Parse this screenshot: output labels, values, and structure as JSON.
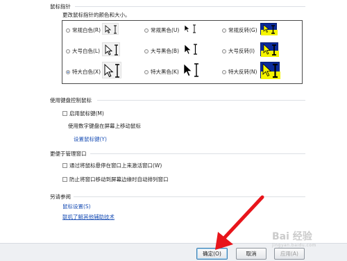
{
  "pointer_group": {
    "title": "鼠标指针",
    "description": "更改鼠标指针的颜色和大小。",
    "options": [
      {
        "label": "常规白色(R)",
        "selected": false,
        "scheme": "white",
        "size": "normal"
      },
      {
        "label": "常规黑色(U)",
        "selected": false,
        "scheme": "black",
        "size": "normal"
      },
      {
        "label": "常规反转(G)",
        "selected": false,
        "scheme": "inverted",
        "size": "normal"
      },
      {
        "label": "大号白色(L)",
        "selected": false,
        "scheme": "white",
        "size": "large"
      },
      {
        "label": "大号黑色(B)",
        "selected": false,
        "scheme": "black",
        "size": "large"
      },
      {
        "label": "大号反转(I)",
        "selected": false,
        "scheme": "inverted",
        "size": "large"
      },
      {
        "label": "特大白色(X)",
        "selected": true,
        "scheme": "white",
        "size": "xlarge"
      },
      {
        "label": "特大黑色(K)",
        "selected": false,
        "scheme": "black",
        "size": "xlarge"
      },
      {
        "label": "特大反转(N)",
        "selected": false,
        "scheme": "inverted",
        "size": "xlarge"
      }
    ]
  },
  "keyboard_group": {
    "title": "使用键盘控制鼠标",
    "checkbox_label": "启用鼠标键(M)",
    "checked": false,
    "hint": "使用数字键盘在屏幕上移动鼠标",
    "link": "设置鼠标键(Y)"
  },
  "window_group": {
    "title": "更便于管理窗口",
    "hover_activate_label": "通过将鼠标悬停在窗口上来激活窗口(W)",
    "hover_activate_checked": false,
    "prevent_arrange_label": "防止将窗口移动到屏幕边缘时自动排列窗口",
    "prevent_arrange_checked": false
  },
  "see_also": {
    "title": "另请参阅",
    "links": [
      "鼠标设置(S)",
      "联机了解其他辅助技术"
    ]
  },
  "footer": {
    "ok_label": "确定(O)",
    "cancel_label": "取消",
    "apply_label": "应用(A)"
  },
  "colors": {
    "annotation_arrow": "#e8151b",
    "link": "#1a4fb5",
    "inverted_preview": "#0b2a9a"
  },
  "watermark": {
    "text": "Bai 经验",
    "subtext": "jingyan.baidu.com"
  }
}
